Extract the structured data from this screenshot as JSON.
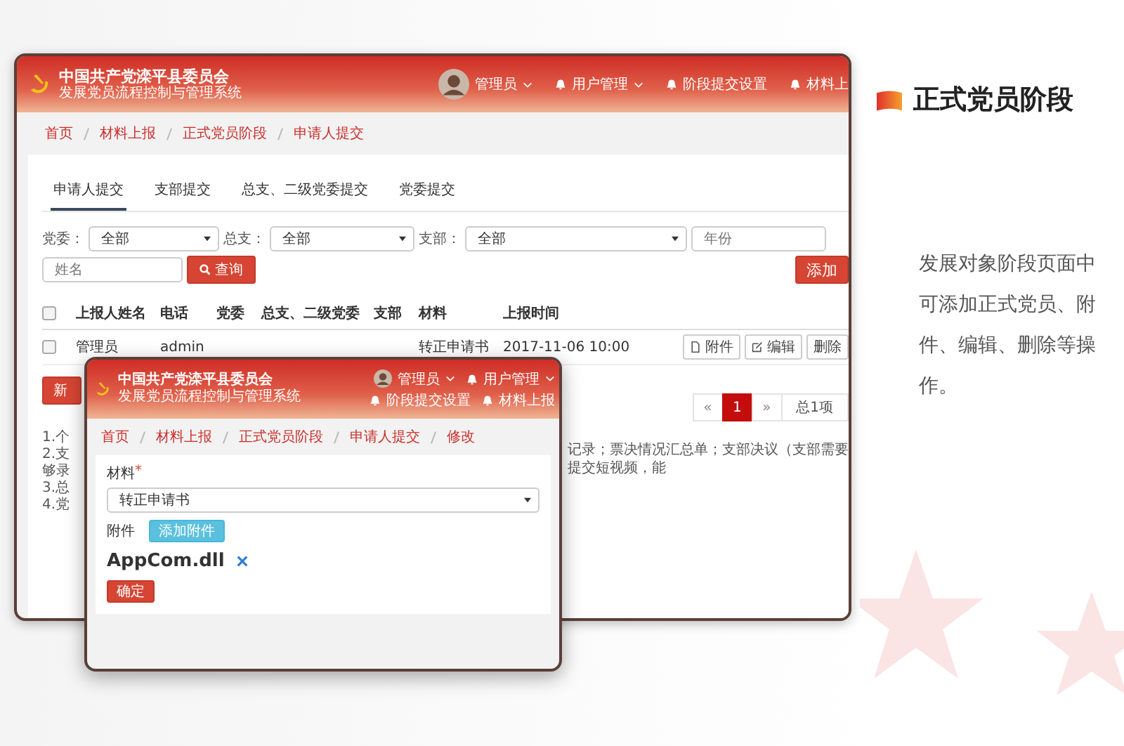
{
  "main_window": {
    "header": {
      "title": "中国共产党滦平县委员会",
      "subtitle": "发展党员流程控制与管理系统",
      "nav": [
        {
          "label": "管理员",
          "kind": "user",
          "dropdown": true
        },
        {
          "label": "用户管理",
          "kind": "menu",
          "dropdown": true
        },
        {
          "label": "阶段提交设置",
          "kind": "menu",
          "dropdown": false
        },
        {
          "label": "材料上",
          "kind": "menu",
          "dropdown": false
        }
      ]
    },
    "breadcrumb": [
      "首页",
      "材料上报",
      "正式党员阶段",
      "申请人提交"
    ],
    "tabs": [
      {
        "label": "申请人提交",
        "selected": true
      },
      {
        "label": "支部提交",
        "selected": false
      },
      {
        "label": "总支、二级党委提交",
        "selected": false
      },
      {
        "label": "党委提交",
        "selected": false
      }
    ],
    "filters": [
      {
        "label": "党委：",
        "value": "全部"
      },
      {
        "label": "总支：",
        "value": "全部"
      },
      {
        "label": "支部：",
        "value": "全部"
      }
    ],
    "year_field": {
      "placeholder": "年份"
    },
    "name_field": {
      "placeholder": "姓名"
    },
    "search_button": "查询",
    "add_button": "添加",
    "table": {
      "header_checked": false,
      "columns": [
        "上报人姓名",
        "电话",
        "党委",
        "总支、二级党委",
        "支部",
        "材料",
        "上报时间"
      ],
      "rows": [
        {
          "checked": false,
          "name": "管理员",
          "phone": "admin",
          "material": "转正申请书",
          "time": "2017-11-06 10:00",
          "actions": [
            {
              "label": "附件",
              "kind": "file"
            },
            {
              "label": "编辑",
              "kind": "edit"
            },
            {
              "label": "删除",
              "kind": "delete"
            }
          ]
        }
      ]
    },
    "partial_button": "新",
    "pagination": {
      "prev": "«",
      "pages": [
        {
          "label": "1",
          "selected": true
        }
      ],
      "next": "»",
      "total": "总1项"
    },
    "notes": {
      "left_fragments": [
        "1.个",
        "2.支",
        "够录",
        "3.总",
        "4.党"
      ],
      "right_fragment": "记录；票决情况汇总单；支部决议（支部需要提交短视频，能"
    }
  },
  "edit_window": {
    "header": {
      "title": "中国共产党滦平县委员会",
      "subtitle": "发展党员流程控制与管理系统",
      "nav": [
        {
          "label": "管理员",
          "kind": "user",
          "dropdown": true
        },
        {
          "label": "用户管理",
          "kind": "menu",
          "dropdown": true
        },
        {
          "label": "阶段提交设置",
          "kind": "menu",
          "dropdown": false
        },
        {
          "label": "材料上报",
          "kind": "menu",
          "dropdown": false
        }
      ]
    },
    "breadcrumb": [
      "首页",
      "材料上报",
      "正式党员阶段",
      "申请人提交",
      "修改"
    ],
    "form": {
      "material_label": "材料",
      "required_mark": "*",
      "material_value": "转正申请书",
      "attachment_label": "附件",
      "add_attachment_button": "添加附件",
      "file": "AppCom.dll",
      "submit_button": "确定"
    }
  },
  "side_panel": {
    "title": "正式党员阶段",
    "description": "发展对象阶段页面中可添加正式党员、附件、编辑、删除等操作。"
  }
}
